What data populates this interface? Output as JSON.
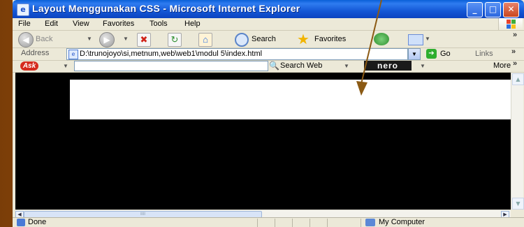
{
  "window": {
    "title": "Layout Menggunakan CSS - Microsoft Internet Explorer",
    "minimize_label": "_",
    "maximize_label": "□",
    "close_label": "✕"
  },
  "menu": [
    "File",
    "Edit",
    "View",
    "Favorites",
    "Tools",
    "Help"
  ],
  "toolbar": {
    "back_label": "Back",
    "search_label": "Search",
    "favorites_label": "Favorites"
  },
  "address": {
    "label": "Address",
    "value": "D:\\trunojoyo\\si,metnum,web\\web1\\modul 5\\index.html",
    "go_label": "Go",
    "links_label": "Links"
  },
  "ask_toolbar": {
    "logo_text": "Ask",
    "input_value": "",
    "search_web_label": "Search Web",
    "nero_text": "nero",
    "more_label": "More"
  },
  "scrollbar": {
    "thumb_grip": "IIII"
  },
  "status": {
    "done_label": "Done",
    "zone_label": "My Computer"
  },
  "colors": {
    "content_background": "#000000",
    "content_block": "#ffffff",
    "arrow": "#8b5a14"
  }
}
